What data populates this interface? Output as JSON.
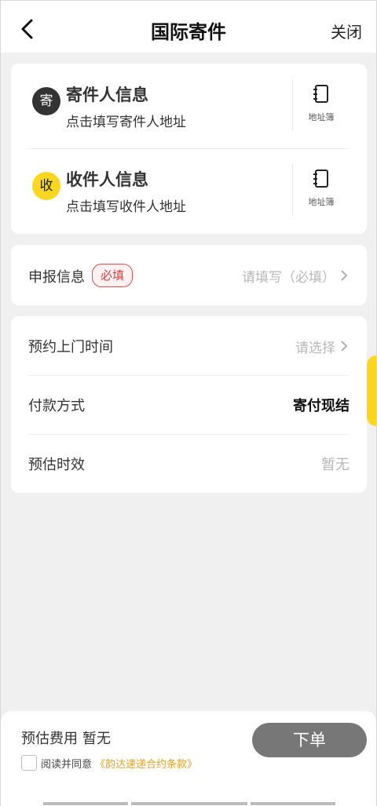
{
  "header": {
    "title": "国际寄件",
    "close_label": "关闭"
  },
  "sender": {
    "badge": "寄",
    "title": "寄件人信息",
    "subtitle": "点击填写寄件人地址",
    "book_label": "地址簿"
  },
  "receiver": {
    "badge": "收",
    "title": "收件人信息",
    "subtitle": "点击填写收件人地址",
    "book_label": "地址簿"
  },
  "declare": {
    "label": "申报信息",
    "required_tag": "必填",
    "placeholder": "请填写（必填）"
  },
  "schedule": {
    "pickup_label": "预约上门时间",
    "pickup_placeholder": "请选择",
    "payment_label": "付款方式",
    "payment_value": "寄付现结",
    "estimate_label": "预估时效",
    "estimate_value": "暂无"
  },
  "footer": {
    "fee_label": "预估费用",
    "fee_value": "暂无",
    "order_button": "下单",
    "agree_text": "阅读并同意",
    "agree_link": "《韵达速递合约条款》"
  },
  "colors": {
    "accent_yellow": "#fbd620",
    "required_red": "#e23b3b",
    "link_orange": "#e3a220",
    "button_grey": "#777777"
  }
}
